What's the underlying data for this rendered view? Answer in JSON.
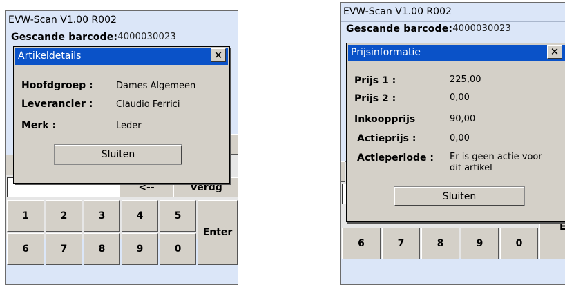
{
  "left": {
    "title": "EVW-Scan V1.00 R002",
    "barcode_label": "Gescande barcode:",
    "barcode_value": "4000030023",
    "dialog": {
      "title": "Artikeldetails",
      "close": "✕",
      "rows": [
        {
          "label": "Hoofdgroep :",
          "value": "Dames Algemeen"
        },
        {
          "label": "Leverancier :",
          "value": "Claudio Ferrici"
        },
        {
          "label": "Merk :",
          "value": "Leder"
        }
      ],
      "button": "Sluiten"
    },
    "backspace": "<--",
    "verdg": "Verdg",
    "keys": [
      "1",
      "2",
      "3",
      "4",
      "5",
      "6",
      "7",
      "8",
      "9",
      "0"
    ],
    "enter": "Enter"
  },
  "right": {
    "title": "EVW-Scan V1.00 R002",
    "barcode_label": "Gescande barcode:",
    "barcode_value": "4000030023",
    "dialog": {
      "title": "Prijsinformatie",
      "close": "✕",
      "rows": [
        {
          "label": "Prijs 1 :",
          "value": "225,00"
        },
        {
          "label": "Prijs 2 :",
          "value": "0,00"
        },
        {
          "label": "Inkoopprijs",
          "value": "90,00"
        },
        {
          "label": "Actieprijs :",
          "value": "0,00"
        },
        {
          "label": "Actieperiode :",
          "value": "Er is geen actie voor",
          "value2": "dit artikel"
        }
      ],
      "button": "Sluiten"
    },
    "keys": [
      "6",
      "7",
      "8",
      "9",
      "0"
    ],
    "enter": "Enter"
  }
}
